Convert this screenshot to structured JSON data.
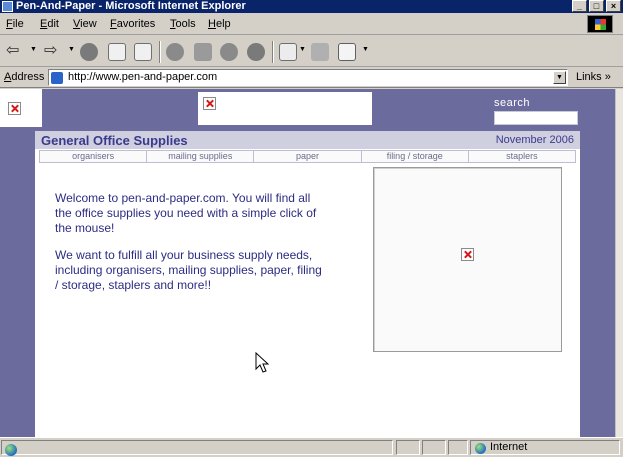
{
  "window": {
    "title": "Pen-And-Paper - Microsoft Internet Explorer",
    "buttons": [
      "_",
      "□",
      "×"
    ]
  },
  "menu": {
    "items": [
      "File",
      "Edit",
      "View",
      "Favorites",
      "Tools",
      "Help"
    ]
  },
  "toolbar": {
    "icons": [
      "back-icon",
      "forward-icon",
      "stop-icon",
      "refresh-icon",
      "home-icon",
      "search-icon",
      "favorites-icon",
      "history-icon",
      "media-icon",
      "mail-icon",
      "print-icon",
      "edit-icon"
    ]
  },
  "address": {
    "label": "Address",
    "url": "http://www.pen-and-paper.com",
    "links_label": "Links »"
  },
  "page": {
    "search_label": "search",
    "site_title": "General Office Supplies",
    "date": "November 2006",
    "nav": [
      "organisers",
      "mailing supplies",
      "paper",
      "filing / storage",
      "staplers"
    ],
    "welcome_paragraphs": [
      "Welcome to pen-and-paper.com.  You will find all the office supplies you need with a simple click of the mouse!",
      "We want to fulfill all your business supply needs, including organisers, mailing supplies, paper, filing / storage, staplers and more!!"
    ]
  },
  "status": {
    "zone": "Internet"
  },
  "colors": {
    "page_background": "#6c6b9e",
    "title_text": "#3a3a8c",
    "body_text": "#2c2c84",
    "titlebar": "#0a246a"
  }
}
